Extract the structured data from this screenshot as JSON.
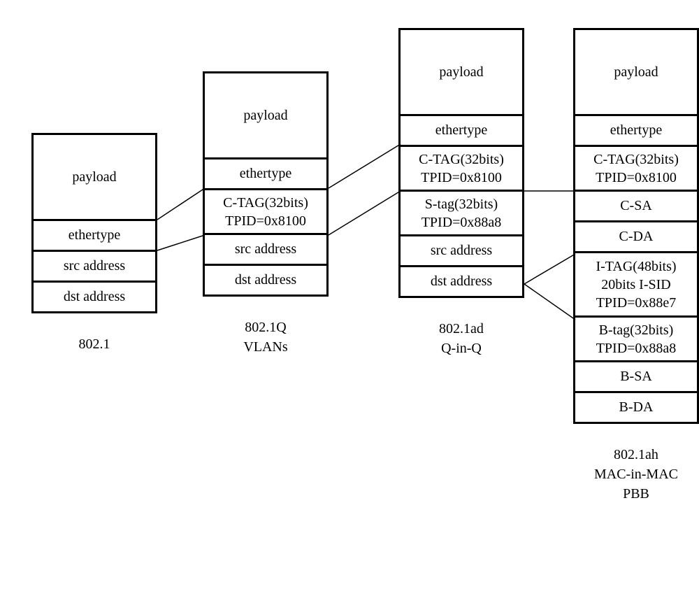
{
  "columns": [
    {
      "caption": "802.1",
      "cells": [
        "payload",
        "ethertype",
        "src address",
        "dst address"
      ]
    },
    {
      "caption": "802.1Q\nVLANs",
      "cells": [
        "payload",
        "ethertype",
        "C-TAG(32bits)\nTPID=0x8100",
        "src address",
        "dst address"
      ]
    },
    {
      "caption": "802.1ad\nQ-in-Q",
      "cells": [
        "payload",
        "ethertype",
        "C-TAG(32bits)\nTPID=0x8100",
        "S-tag(32bits)\nTPID=0x88a8",
        "src address",
        "dst address"
      ]
    },
    {
      "caption": "802.1ah\nMAC-in-MAC\nPBB",
      "cells": [
        "payload",
        "ethertype",
        "C-TAG(32bits)\nTPID=0x8100",
        "C-SA",
        "C-DA",
        "I-TAG(48bits)\n20bits I-SID\nTPID=0x88e7",
        "B-tag(32bits)\nTPID=0x88a8",
        "B-SA",
        "B-DA"
      ]
    }
  ]
}
